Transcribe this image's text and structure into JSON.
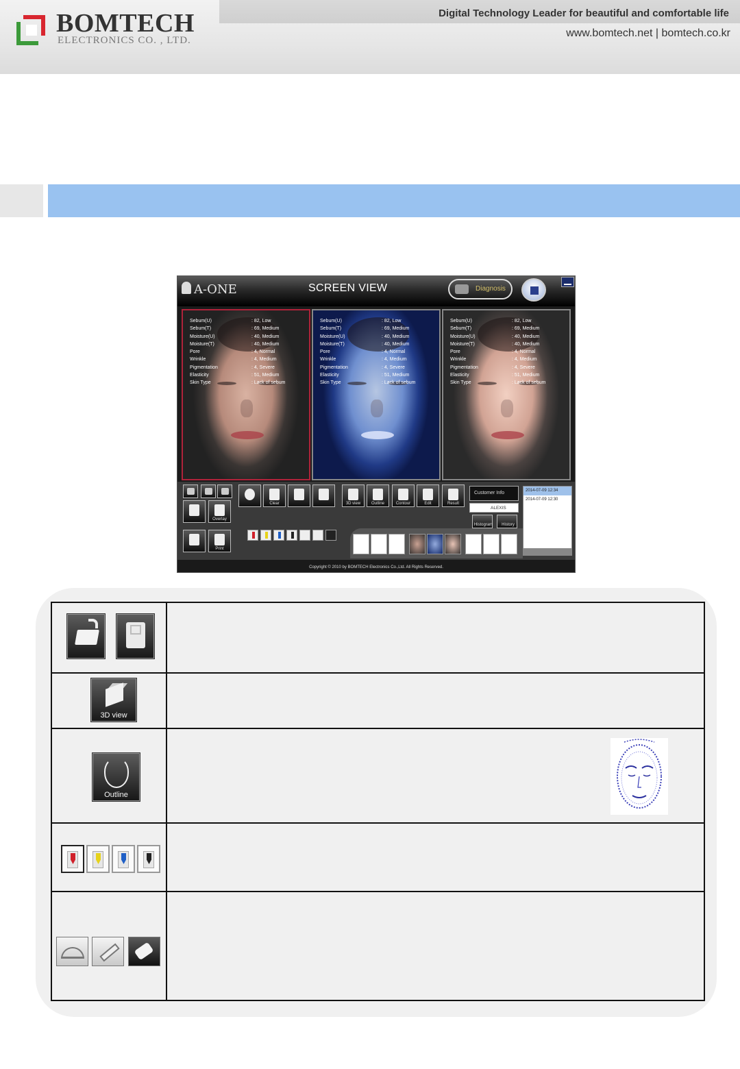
{
  "header": {
    "brand_name": "BOMTECH",
    "brand_sub": "ELECTRONICS CO. , LTD.",
    "tagline": "Digital Technology Leader for beautiful and comfortable life",
    "websites": "www.bomtech.net  |  bomtech.co.kr",
    "logo_colors": {
      "red": "#d8262f",
      "green": "#3c9a3a"
    }
  },
  "section_bar": {
    "color": "#99c2f0"
  },
  "app": {
    "logo": "A-ONE",
    "title": "SCREEN VIEW",
    "diagnosis_button": "Diagnosis",
    "panels": [
      {
        "readings": [
          [
            "Sebum(U)",
            ": 82, Low"
          ],
          [
            "Sebum(T)",
            ": 69, Medium"
          ],
          [
            "Moisture(U)",
            ": 40, Medium"
          ],
          [
            "Moisture(T)",
            ": 40, Medium"
          ],
          [
            "Pore",
            ": 4, Normal"
          ],
          [
            "Wrinkle",
            ": 4, Medium"
          ],
          [
            "Pigmentation",
            ": 4, Severe"
          ],
          [
            "Elasticity",
            ": 51, Medium"
          ],
          [
            "Skin Type",
            ": Lack of sebum"
          ]
        ]
      },
      {
        "readings": [
          [
            "Sebum(U)",
            ": 82, Low"
          ],
          [
            "Sebum(T)",
            ": 69, Medium"
          ],
          [
            "Moisture(U)",
            ": 40, Medium"
          ],
          [
            "Moisture(T)",
            ": 40, Medium"
          ],
          [
            "Pore",
            ": 4, Normal"
          ],
          [
            "Wrinkle",
            ": 4, Medium"
          ],
          [
            "Pigmentation",
            ": 4, Severe"
          ],
          [
            "Elasticity",
            ": 51, Medium"
          ],
          [
            "Skin Type",
            ": Lack of sebum"
          ]
        ]
      },
      {
        "readings": [
          [
            "Sebum(U)",
            ": 82, Low"
          ],
          [
            "Sebum(T)",
            ": 69, Medium"
          ],
          [
            "Moisture(U)",
            ": 40, Medium"
          ],
          [
            "Moisture(T)",
            ": 40, Medium"
          ],
          [
            "Pore",
            ": 4, Normal"
          ],
          [
            "Wrinkle",
            ": 4, Medium"
          ],
          [
            "Pigmentation",
            ": 4, Severe"
          ],
          [
            "Elasticity",
            ": 51, Medium"
          ],
          [
            "Skin Type",
            ": Lack of sebum"
          ]
        ]
      }
    ],
    "toolbar": {
      "overlay": "Overlay",
      "print": "Print",
      "clear": "Clear",
      "view3d": "3D view",
      "outline": "Outline",
      "contour": "Contour",
      "edit": "Edit",
      "result": "Result",
      "customer_info": "Customer Info",
      "customer_name": "ALEXIS",
      "histogram": "Histogram",
      "history": "History",
      "dates": [
        "2014-07-09 12:34",
        "2014-07-09 12:30"
      ]
    },
    "copyright": "Copyright © 2010 by BOMTECH Electronics Co.,Ltd. All Rights Reserved."
  },
  "table": {
    "rows": [
      {
        "icons": [
          "open-folder-icon",
          "save-disk-icon"
        ],
        "description": ""
      },
      {
        "icons": [
          "3d-view-icon"
        ],
        "label": "3D view",
        "description": ""
      },
      {
        "icons": [
          "outline-face-icon"
        ],
        "label": "Outline",
        "description": ""
      },
      {
        "icons": [
          "red-pen-icon",
          "yellow-pen-icon",
          "blue-pen-icon",
          "black-pen-icon"
        ],
        "pen_colors": [
          "#d0202a",
          "#e6d21a",
          "#1f5fc6",
          "#222222"
        ],
        "description": ""
      },
      {
        "icons": [
          "protractor-icon",
          "ruler-icon",
          "eraser-icon"
        ],
        "description": ""
      }
    ]
  }
}
